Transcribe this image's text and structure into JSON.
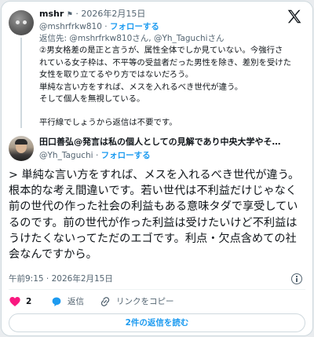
{
  "quoted_tweet": {
    "author_name": "mshr",
    "date": "· 2026年2月15日",
    "handle": "@mshrfrkw810",
    "follow_label": "フォローする",
    "reply_to_prefix": "返信先: ",
    "reply_to_users": "@mshrfrkw810さん, @Yh_Taguchiさん",
    "body_lines": [
      "②男女格差の是正と言うが、属性全体でしか見ていない。今強行さ",
      "れている女子枠は、不平等の受益者だった男性を除き、差別を受けた",
      "女性を取り立てるやり方ではないだろう。",
      "単純な言い方をすれば、メスを入れるべき世代が違う。",
      "そして個人を無視している。"
    ],
    "body_last_line": "平行線でしょうから返信は不要です。"
  },
  "main_tweet": {
    "author_name": "田口善弘@発言は私の個人としての見解であり中央大学やそ…",
    "handle": "@Yh_Taguchi",
    "follow_label": "フォローする",
    "body": "> 単純な言い方をすれば、メスを入れるべき世代が違う。根本的な考え間違いです。若い世代は不利益だけじゃなく前の世代の作った社会の利益もある意味タダで享受しているのです。前の世代が作った利益は受けたいけど不利益はうけたくないってただのエゴです。利点・欠点含めての社会なんですから。",
    "timestamp": "午前9:15 · 2026年2月15日",
    "like_count": "2",
    "reply_label": "返信",
    "copy_link_label": "リンクをコピー",
    "read_replies_label": "2件の返信を読む"
  },
  "icons": {
    "logo": "x-logo-icon",
    "like": "heart-icon",
    "reply": "speech-bubble-icon",
    "link": "link-icon",
    "info": "info-icon",
    "more": "more-icon"
  },
  "colors": {
    "accent": "#1d9bf0",
    "like": "#f91880",
    "muted": "#536471",
    "border": "#cfd9de"
  }
}
